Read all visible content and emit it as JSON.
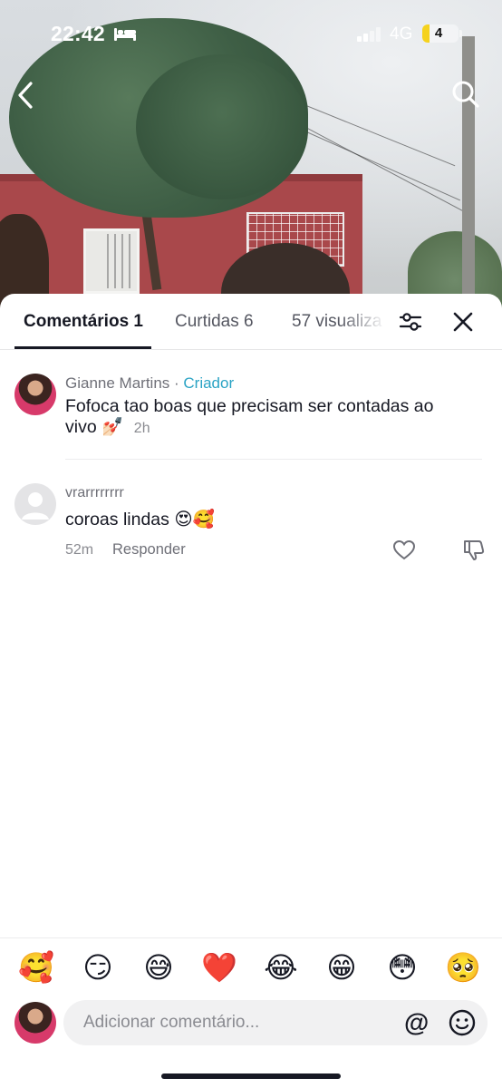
{
  "status_bar": {
    "time": "22:42",
    "network": "4G",
    "battery": "4",
    "battery_level": 0.04
  },
  "icons": {
    "back": "chevron-left-icon",
    "search": "search-icon",
    "filter": "sliders-icon",
    "close": "close-icon",
    "heart": "heart-icon",
    "dislike": "thumbs-down-icon",
    "mention": "at-icon",
    "emoji_picker": "smile-icon",
    "sleep": "bed-icon"
  },
  "tabs": [
    {
      "label": "Comentários 1",
      "active": true
    },
    {
      "label": "Curtidas 6",
      "active": false
    },
    {
      "label": "57 visualiza",
      "active": false
    }
  ],
  "comments": [
    {
      "author": "Gianne Martins",
      "separator": " · ",
      "badge": "Criador",
      "text": "Fofoca tao boas que precisam ser contadas ao vivo 💅🏻",
      "time": "2h"
    },
    {
      "author": "vrarrrrrrrr",
      "text": "coroas lindas 😍🥰",
      "time": "52m",
      "reply_label": "Responder"
    }
  ],
  "emoji_bar": [
    "🥰",
    "😏",
    "😅",
    "❤️",
    "😂",
    "😁",
    "😳",
    "🥺"
  ],
  "composer": {
    "placeholder": "Adicionar comentário...",
    "mention_symbol": "@"
  },
  "colors": {
    "creator_badge": "#2aa3c4",
    "text": "#161823",
    "muted": "#8a8b91",
    "battery_fill": "#f5d21d"
  }
}
